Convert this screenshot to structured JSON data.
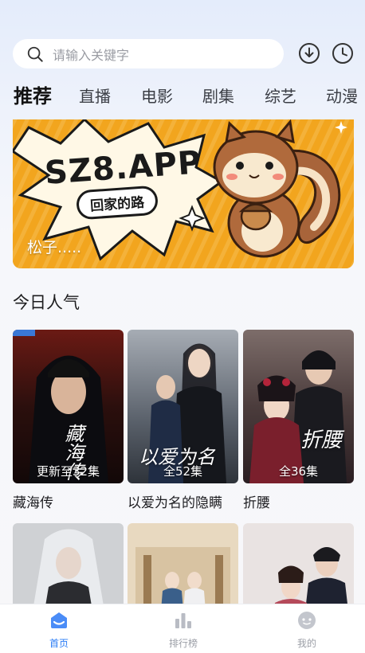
{
  "search": {
    "placeholder": "请输入关键字"
  },
  "header_icons": {
    "download": "download-icon",
    "history": "history-clock-icon"
  },
  "tabs": [
    {
      "label": "推荐",
      "active": true
    },
    {
      "label": "直播",
      "active": false
    },
    {
      "label": "电影",
      "active": false
    },
    {
      "label": "剧集",
      "active": false
    },
    {
      "label": "综艺",
      "active": false
    },
    {
      "label": "动漫",
      "active": false
    }
  ],
  "banner": {
    "title": "SZ8.APP",
    "subtitle": "回家的路",
    "caption": "松子....."
  },
  "section": {
    "title": "今日人气"
  },
  "cards": [
    {
      "name": "藏海传",
      "episodes": "更新至32集",
      "badge": ""
    },
    {
      "name": "以爱为名的隐瞒",
      "episodes": "全52集",
      "poster_text": "以爱为名"
    },
    {
      "name": "折腰",
      "episodes": "全36集",
      "poster_text": "折腰"
    }
  ],
  "poster_text": {
    "card1": "藏海传"
  },
  "bottom_nav": [
    {
      "label": "首页",
      "icon": "home-icon",
      "active": true
    },
    {
      "label": "排行榜",
      "icon": "bar-chart-icon",
      "active": false
    },
    {
      "label": "我的",
      "icon": "profile-face-icon",
      "active": false
    }
  ],
  "colors": {
    "accent": "#2a7cf6",
    "banner_bg": "#f2a51e"
  }
}
